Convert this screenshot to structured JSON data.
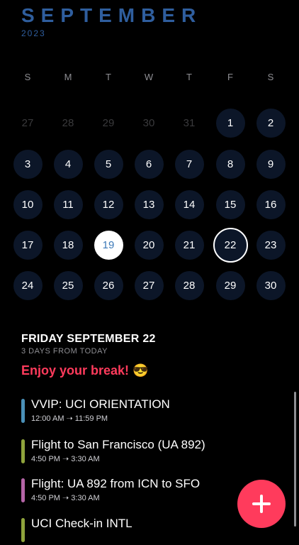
{
  "header": {
    "month": "SEPTEMBER",
    "year": "2023"
  },
  "calendar": {
    "weekdays": [
      "S",
      "M",
      "T",
      "W",
      "T",
      "F",
      "S"
    ],
    "weeks": [
      [
        {
          "d": "27",
          "kind": "dim"
        },
        {
          "d": "28",
          "kind": "dim"
        },
        {
          "d": "29",
          "kind": "dim"
        },
        {
          "d": "30",
          "kind": "dim"
        },
        {
          "d": "31",
          "kind": "dim"
        },
        {
          "d": "1",
          "kind": "normal"
        },
        {
          "d": "2",
          "kind": "normal"
        }
      ],
      [
        {
          "d": "3",
          "kind": "normal"
        },
        {
          "d": "4",
          "kind": "normal"
        },
        {
          "d": "5",
          "kind": "normal"
        },
        {
          "d": "6",
          "kind": "normal"
        },
        {
          "d": "7",
          "kind": "normal"
        },
        {
          "d": "8",
          "kind": "normal"
        },
        {
          "d": "9",
          "kind": "normal"
        }
      ],
      [
        {
          "d": "10",
          "kind": "normal"
        },
        {
          "d": "11",
          "kind": "normal"
        },
        {
          "d": "12",
          "kind": "normal"
        },
        {
          "d": "13",
          "kind": "normal"
        },
        {
          "d": "14",
          "kind": "normal"
        },
        {
          "d": "15",
          "kind": "normal"
        },
        {
          "d": "16",
          "kind": "normal"
        }
      ],
      [
        {
          "d": "17",
          "kind": "normal"
        },
        {
          "d": "18",
          "kind": "normal"
        },
        {
          "d": "19",
          "kind": "today"
        },
        {
          "d": "20",
          "kind": "normal"
        },
        {
          "d": "21",
          "kind": "normal"
        },
        {
          "d": "22",
          "kind": "selected"
        },
        {
          "d": "23",
          "kind": "normal"
        }
      ],
      [
        {
          "d": "24",
          "kind": "normal"
        },
        {
          "d": "25",
          "kind": "normal"
        },
        {
          "d": "26",
          "kind": "normal"
        },
        {
          "d": "27",
          "kind": "normal"
        },
        {
          "d": "28",
          "kind": "normal"
        },
        {
          "d": "29",
          "kind": "normal"
        },
        {
          "d": "30",
          "kind": "normal"
        }
      ]
    ]
  },
  "selected_day": {
    "heading": "FRIDAY SEPTEMBER 22",
    "subheading": "3 DAYS FROM TODAY",
    "note": "Enjoy your break! 😎"
  },
  "events": [
    {
      "title": "VVIP: UCI ORIENTATION",
      "time": "12:00 AM ➝ 11:59 PM",
      "color": "#4a90b8"
    },
    {
      "title": "Flight to San Francisco (UA 892)",
      "time": "4:50 PM ➝ 3:30 AM",
      "color": "#8fa33c"
    },
    {
      "title": "Flight: UA 892 from ICN to SFO",
      "time": "4:50 PM ➝ 3:30 AM",
      "color": "#b565a7"
    },
    {
      "title": "UCI Check-in INTL",
      "time": "",
      "color": "#8fa33c"
    }
  ],
  "colors": {
    "accent": "#ff3b5c",
    "month": "#2f5e9e",
    "day_bg": "#0c1628"
  },
  "fab": {
    "icon": "plus-icon"
  }
}
